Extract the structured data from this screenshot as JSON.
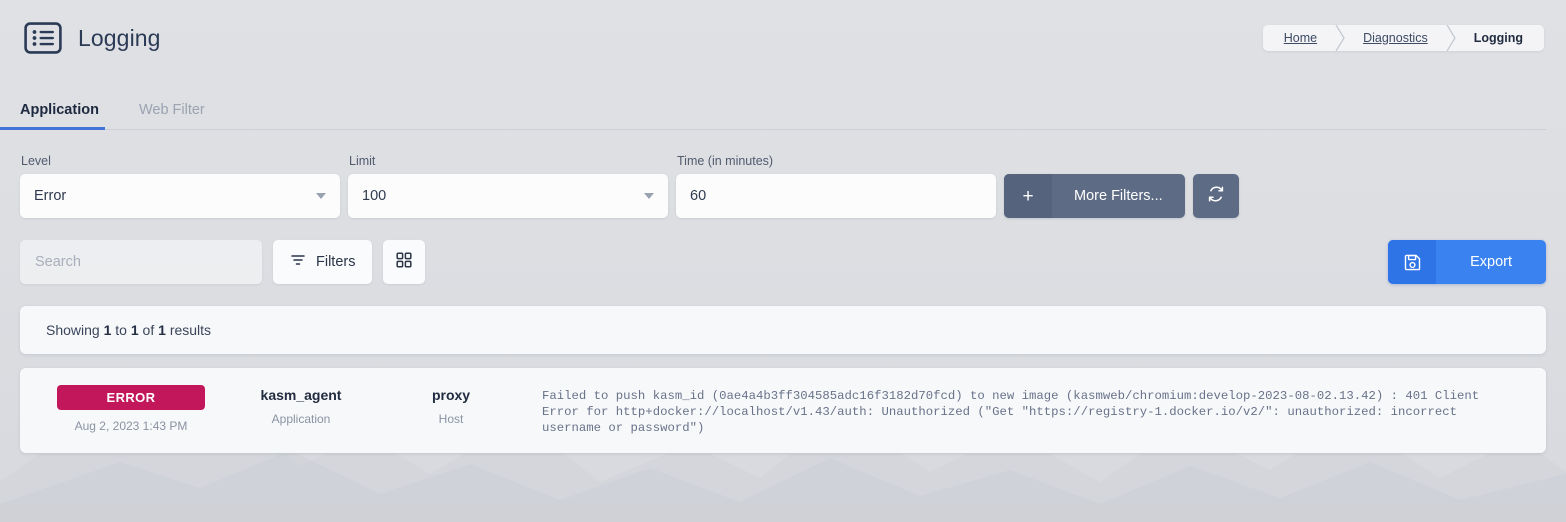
{
  "header": {
    "icon": "list-icon",
    "title": "Logging",
    "breadcrumb": [
      {
        "label": "Home",
        "active": false
      },
      {
        "label": "Diagnostics",
        "active": false
      },
      {
        "label": "Logging",
        "active": true
      }
    ]
  },
  "tabs": [
    {
      "label": "Application",
      "active": true
    },
    {
      "label": "Web Filter",
      "active": false
    }
  ],
  "filters": {
    "level": {
      "label": "Level",
      "value": "Error"
    },
    "limit": {
      "label": "Limit",
      "value": "100"
    },
    "time": {
      "label": "Time (in minutes)",
      "value": "60"
    },
    "more_filters": {
      "label": "More Filters...",
      "icon": "plus-icon"
    },
    "refresh": {
      "icon": "refresh-icon"
    }
  },
  "toolbar": {
    "search_placeholder": "Search",
    "search_value": "",
    "filters_label": "Filters",
    "filters_icon": "funnel-icon",
    "columns_icon": "grid-icon",
    "export_label": "Export",
    "export_icon": "save-icon"
  },
  "results": {
    "prefix": "Showing",
    "from": "1",
    "mid": "to",
    "to": "1",
    "of": "of",
    "total": "1",
    "suffix": "results"
  },
  "log_rows": [
    {
      "level": "ERROR",
      "timestamp": "Aug 2, 2023 1:43 PM",
      "application": "kasm_agent",
      "application_label": "Application",
      "host": "proxy",
      "host_label": "Host",
      "message": "Failed to push kasm_id (0ae4a4b3ff304585adc16f3182d70fcd) to new image (kasmweb/chromium:develop-2023-08-02.13.42) : 401 Client Error for http+docker://localhost/v1.43/auth: Unauthorized (\"Get \"https://registry-1.docker.io/v2/\": unauthorized: incorrect username or password\")"
    }
  ],
  "colors": {
    "accent_blue": "#3b82f1",
    "tab_underline": "#4273d8",
    "error_badge": "#c2185b",
    "slate_button": "#5d6b85",
    "page_bg": "#dcdee2"
  }
}
